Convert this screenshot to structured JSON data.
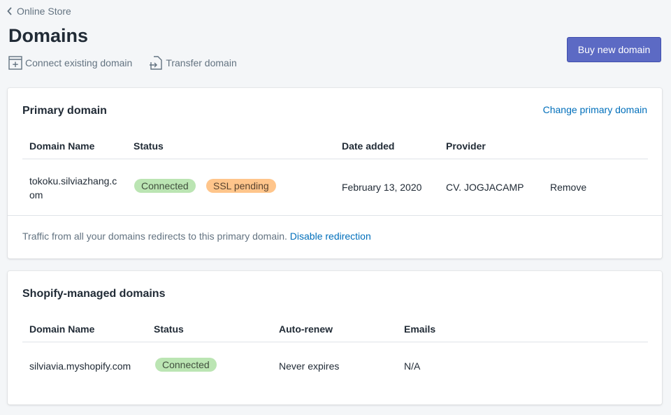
{
  "breadcrumb": {
    "label": "Online Store"
  },
  "page": {
    "title": "Domains"
  },
  "actions": {
    "connect_label": "Connect existing domain",
    "transfer_label": "Transfer domain"
  },
  "buy_button": {
    "label": "Buy new domain"
  },
  "primary": {
    "title": "Primary domain",
    "change_link": "Change primary domain",
    "headers": {
      "name": "Domain Name",
      "status": "Status",
      "date": "Date added",
      "provider": "Provider"
    },
    "row": {
      "domain_line1": "tokoku.silviazhang.c",
      "domain_line2": "om",
      "status_badge": "Connected",
      "ssl_badge": "SSL pending",
      "date": "February 13, 2020",
      "provider": "CV. JOGJACAMP",
      "remove": "Remove"
    },
    "footer_text": "Traffic from all your domains redirects to this primary domain.",
    "footer_link": "Disable redirection"
  },
  "managed": {
    "title": "Shopify-managed domains",
    "headers": {
      "name": "Domain Name",
      "status": "Status",
      "autorenew": "Auto-renew",
      "emails": "Emails"
    },
    "row": {
      "domain": "silviavia.myshopify.com",
      "status_badge": "Connected",
      "autorenew": "Never expires",
      "emails": "N/A"
    }
  },
  "colors": {
    "primary_button": "#5c6ac4",
    "link": "#006fbb",
    "badge_success": "#bbe5b3",
    "badge_warning": "#ffc58b"
  },
  "icons": {
    "back": "chevron-left-icon",
    "connect": "add-domain-icon",
    "transfer": "transfer-domain-icon"
  }
}
